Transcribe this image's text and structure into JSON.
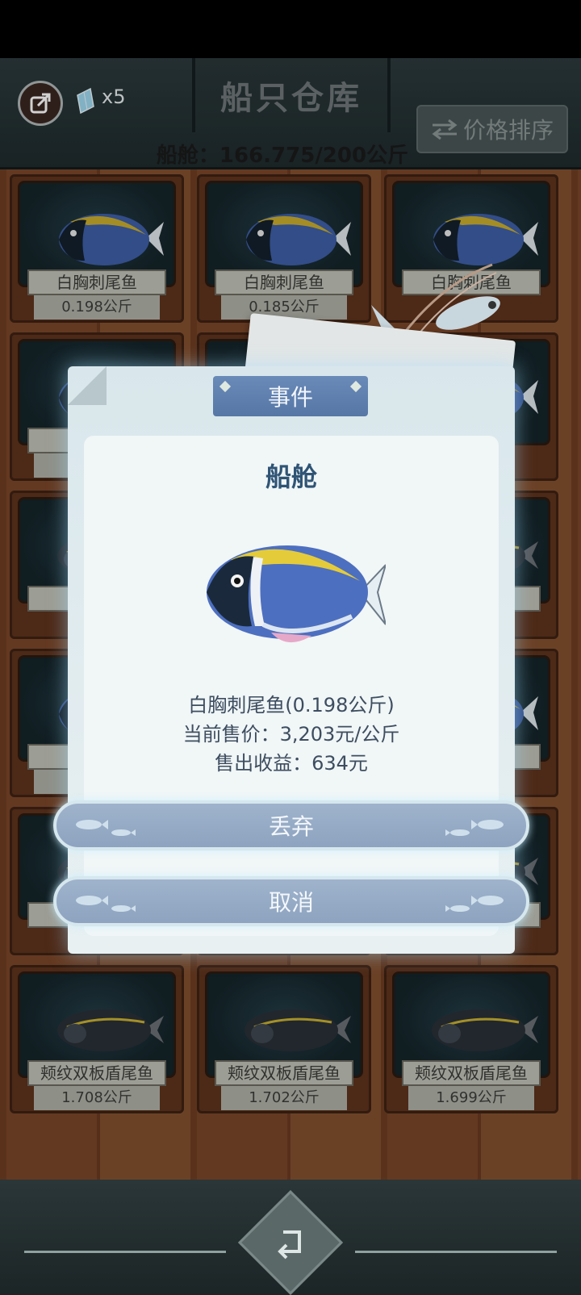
{
  "header": {
    "title": "船只仓库",
    "gem_count": "x5",
    "sort_label": "价格排序",
    "capacity": "船舱：166.775/200公斤"
  },
  "grid": {
    "rows": [
      [
        {
          "name": "白胸刺尾鱼",
          "weight": "0.198公斤"
        },
        {
          "name": "白胸刺尾鱼",
          "weight": "0.185公斤"
        },
        {
          "name": "白胸刺尾鱼",
          "weight": ""
        }
      ],
      [
        {
          "name": "白",
          "weight": "0"
        },
        {
          "name": "",
          "weight": ""
        },
        {
          "name": "",
          "weight": ""
        }
      ],
      [
        {
          "name": "颊纹",
          "weight": ""
        },
        {
          "name": "",
          "weight": ""
        },
        {
          "name": "尾鱼",
          "weight": ""
        }
      ],
      [
        {
          "name": "白",
          "weight": "0"
        },
        {
          "name": "",
          "weight": ""
        },
        {
          "name": "尾鱼",
          "weight": ""
        }
      ],
      [
        {
          "name": "颊",
          "weight": ""
        },
        {
          "name": "",
          "weight": ""
        },
        {
          "name": "鱼",
          "weight": ""
        }
      ],
      [
        {
          "name": "颊纹双板盾尾鱼",
          "weight": "1.708公斤"
        },
        {
          "name": "颊纹双板盾尾鱼",
          "weight": "1.702公斤"
        },
        {
          "name": "颊纹双板盾尾鱼",
          "weight": "1.699公斤"
        }
      ]
    ]
  },
  "modal": {
    "tab": "事件",
    "title": "船舱",
    "fish_info": "白胸刺尾鱼(0.198公斤)",
    "price": "当前售价：3,203元/公斤",
    "income": "售出收益：634元",
    "discard_label": "丢弃",
    "cancel_label": "取消"
  },
  "colors": {
    "accent": "#5677a6",
    "button": "#8da3bf",
    "wood": "#7a4629"
  },
  "icons": {
    "back": "exit-arrow-icon",
    "gem": "diamond-icon",
    "sort": "swap-arrows-icon",
    "home": "return-icon"
  }
}
